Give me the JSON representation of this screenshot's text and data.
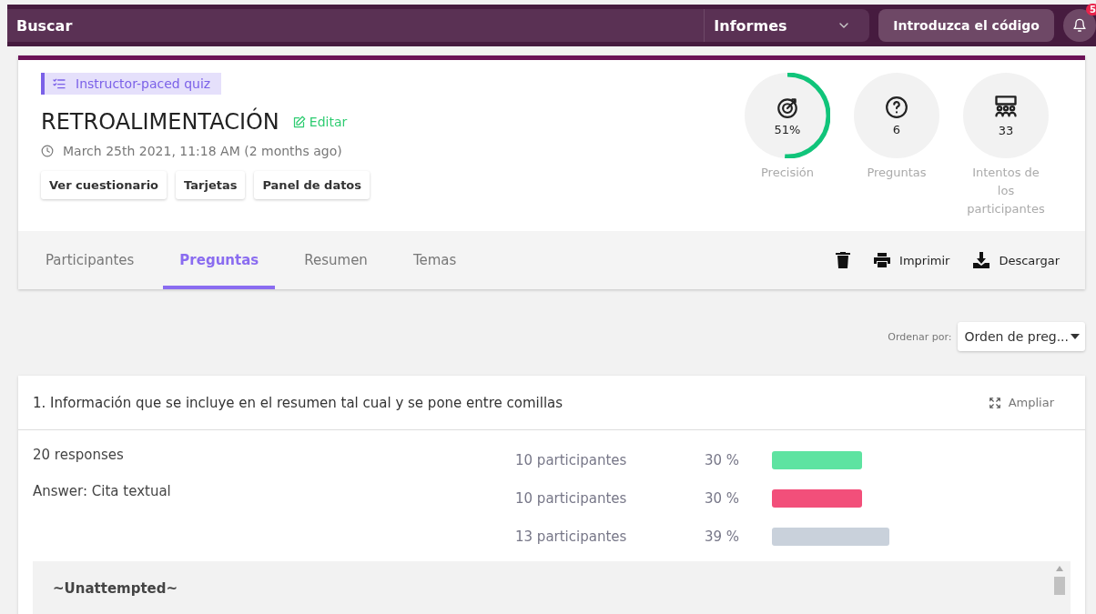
{
  "topbar": {
    "search": "Buscar",
    "menu": "Informes",
    "code_button": "Introduzca el código",
    "notifications": "5"
  },
  "quiz": {
    "badge": "Instructor-paced quiz",
    "title": "RETROALIMENTACIÓN",
    "edit": "Editar",
    "date": "March 25th 2021, 11:18 AM (2 months ago)",
    "buttons": [
      "Ver cuestionario",
      "Tarjetas",
      "Panel de datos"
    ]
  },
  "stats": [
    {
      "kind": "accuracy",
      "value": "51%",
      "label": "Precisión"
    },
    {
      "kind": "questions",
      "value": "6",
      "label": "Preguntas"
    },
    {
      "kind": "attempts",
      "value": "33",
      "label": "Intentos de los participantes"
    }
  ],
  "tabs": [
    {
      "label": "Participantes",
      "selected": false
    },
    {
      "label": "Preguntas",
      "selected": true
    },
    {
      "label": "Resumen",
      "selected": false
    },
    {
      "label": "Temas",
      "selected": false
    }
  ],
  "actions": [
    {
      "kind": "delete"
    },
    {
      "kind": "print",
      "label": "Imprimir"
    },
    {
      "kind": "download",
      "label": "Descargar"
    }
  ],
  "sort": {
    "label": "Ordenar por:",
    "value": "Orden de preg..."
  },
  "question": {
    "title": "1. Información que se incluye en el resumen tal cual y se pone entre comillas",
    "expand": "Ampliar",
    "responses": "20 responses",
    "answer": "Answer: Cita textual",
    "rows": [
      {
        "participants": "10 participantes",
        "percent": "30 %",
        "color": "#5ee3a1"
      },
      {
        "participants": "10 participantes",
        "percent": "30 %",
        "color": "#f24f7a"
      },
      {
        "participants": "13 participantes",
        "percent": "39 %",
        "color": "#c9d1db"
      }
    ],
    "unattempted": "~Unattempted~"
  }
}
